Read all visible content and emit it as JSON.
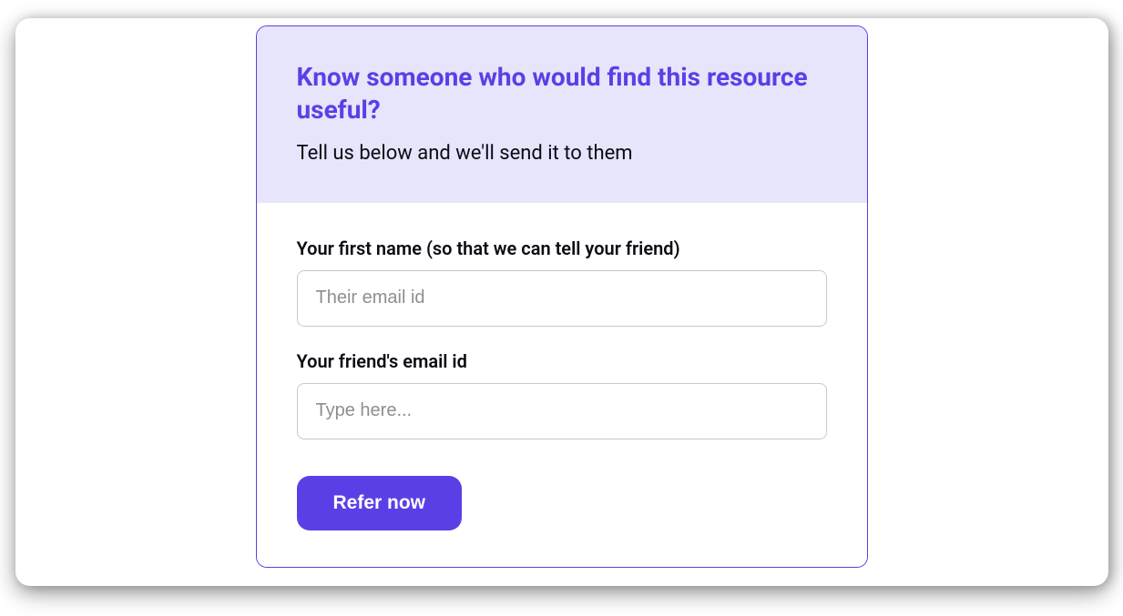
{
  "header": {
    "title": "Know someone who would find this resource useful?",
    "subtitle": "Tell us below and we'll send it to them"
  },
  "form": {
    "fields": [
      {
        "label": "Your first name (so that we can tell your friend)",
        "placeholder": "Their email id",
        "value": ""
      },
      {
        "label": "Your friend's email id",
        "placeholder": "Type here...",
        "value": ""
      }
    ],
    "submit_label": "Refer now"
  },
  "colors": {
    "accent": "#5B3FE6",
    "header_bg": "#E6E5FB",
    "text_dark": "#0B0B14",
    "border_input": "#C9C9C9",
    "placeholder": "#8E8E8E"
  }
}
